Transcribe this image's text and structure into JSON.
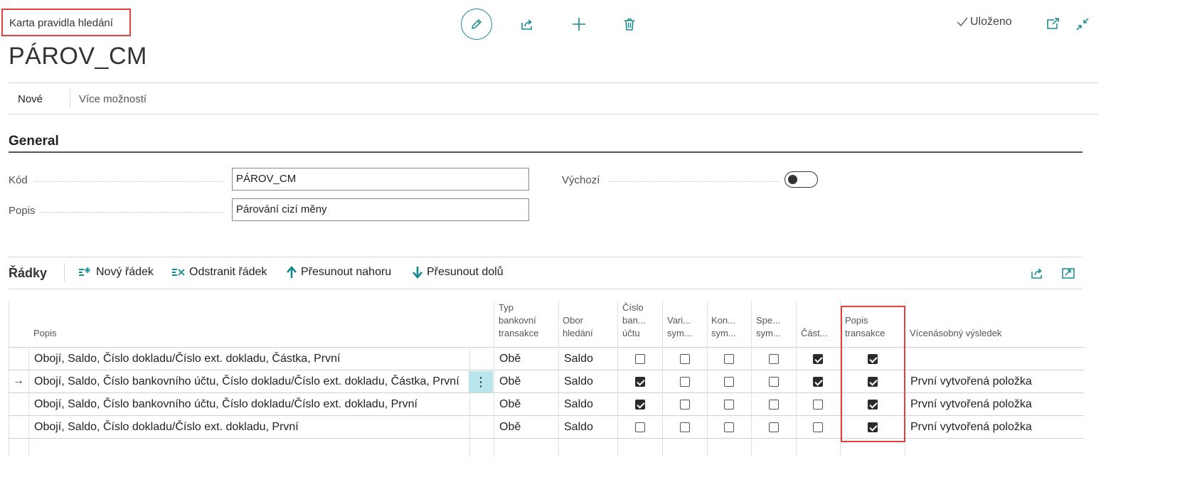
{
  "page": {
    "caption": "Karta pravidla hledání",
    "title": "PÁROV_CM",
    "saved_label": "Uloženo"
  },
  "top_actions": {
    "icons": [
      "edit-icon",
      "share-icon",
      "add-icon",
      "delete-icon",
      "open-new-window-icon",
      "collapse-icon"
    ]
  },
  "action_bar": {
    "new_label": "Nové",
    "more_label": "Více možností"
  },
  "general": {
    "title": "General",
    "kod_label": "Kód",
    "kod_value": "PÁROV_CM",
    "popis_label": "Popis",
    "popis_value": "Párování cizí měny",
    "vychozi_label": "Výchozí",
    "vychozi_value": false
  },
  "lines": {
    "title": "Řádky",
    "new_line": "Nový řádek",
    "delete_line": "Odstranit řádek",
    "move_up": "Přesunout nahoru",
    "move_down": "Přesunout dolů",
    "headers": {
      "popis": "Popis",
      "typ_1": "Typ",
      "typ_2": "bankovní",
      "typ_3": "transakce",
      "obor_1": "Obor",
      "obor_2": "hledání",
      "cislo_1": "Číslo",
      "cislo_2": "ban...",
      "cislo_3": "účtu",
      "vari_1": "Vari...",
      "vari_2": "sym...",
      "kon_1": "Kon...",
      "kon_2": "sym...",
      "spe_1": "Spe...",
      "spe_2": "sym...",
      "cast": "Část...",
      "popis_trans_1": "Popis",
      "popis_trans_2": "transakce",
      "vicenasobny": "Vícenásobný výsledek"
    },
    "rows": [
      {
        "popis": "Obojí, Saldo, Číslo dokladu/Číslo ext. dokladu, Částka, První",
        "typ": "Obě",
        "obor": "Saldo",
        "cislo_uctu": false,
        "vari": false,
        "kon": false,
        "spe": false,
        "castka": true,
        "popis_transakce": true,
        "vicenasobny": ""
      },
      {
        "popis": "Obojí, Saldo, Číslo bankovního účtu, Číslo dokladu/Číslo ext. dokladu, Částka, První",
        "typ": "Obě",
        "obor": "Saldo",
        "cislo_uctu": true,
        "vari": false,
        "kon": false,
        "spe": false,
        "castka": true,
        "popis_transakce": true,
        "vicenasobny": "První vytvořená položka",
        "selected": true
      },
      {
        "popis": "Obojí, Saldo, Číslo bankovního účtu, Číslo dokladu/Číslo ext. dokladu, První",
        "typ": "Obě",
        "obor": "Saldo",
        "cislo_uctu": true,
        "vari": false,
        "kon": false,
        "spe": false,
        "castka": false,
        "popis_transakce": true,
        "vicenasobny": "První vytvořená položka"
      },
      {
        "popis": "Obojí, Saldo, Číslo dokladu/Číslo ext. dokladu, První",
        "typ": "Obě",
        "obor": "Saldo",
        "cislo_uctu": false,
        "vari": false,
        "kon": false,
        "spe": false,
        "castka": false,
        "popis_transakce": true,
        "vicenasobny": "První vytvořená položka"
      }
    ]
  },
  "colors": {
    "accent": "#128a8f",
    "highlight": "#e0413f",
    "selected_cell": "#b8e6ec"
  }
}
